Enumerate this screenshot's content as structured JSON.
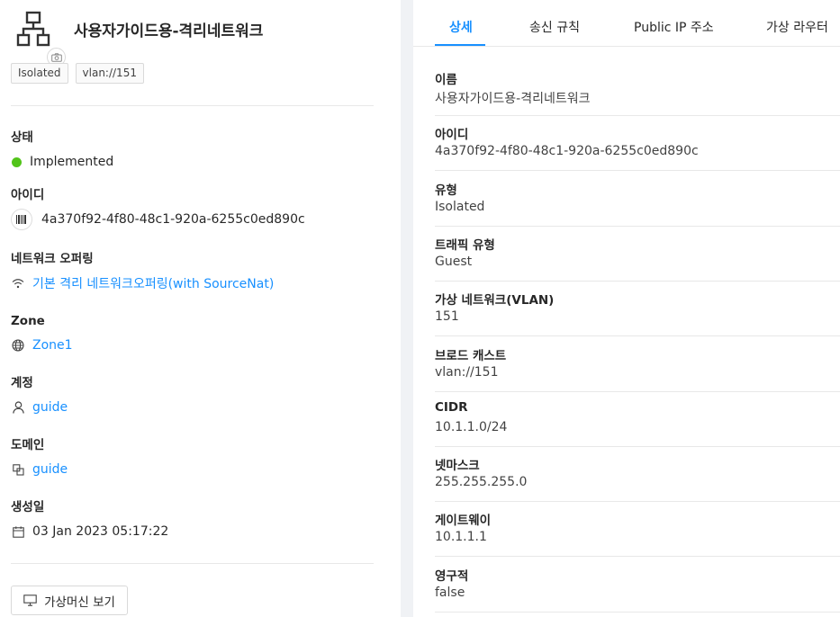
{
  "header": {
    "title": "사용자가이드용-격리네트워크",
    "tags": [
      "Isolated",
      "vlan://151"
    ]
  },
  "fields": {
    "status": {
      "label": "상태",
      "value": "Implemented",
      "color": "#52c41a"
    },
    "id": {
      "label": "아이디",
      "value": "4a370f92-4f80-48c1-920a-6255c0ed890c",
      "icon": "barcode-icon"
    },
    "offering": {
      "label": "네트워크 오퍼링",
      "value": "기본 격리 네트워크오퍼링(with SourceNat)",
      "icon": "wifi-icon"
    },
    "zone": {
      "label": "Zone",
      "value": "Zone1",
      "icon": "globe-icon"
    },
    "account": {
      "label": "계정",
      "value": "guide",
      "icon": "user-icon"
    },
    "domain": {
      "label": "도메인",
      "value": "guide",
      "icon": "block-icon"
    },
    "created": {
      "label": "생성일",
      "value": "03 Jan 2023 05:17:22",
      "icon": "calendar-icon"
    }
  },
  "vm_button": {
    "label": "가상머신 보기",
    "icon": "desktop-icon"
  },
  "tabs": [
    {
      "label": "상세",
      "active": true
    },
    {
      "label": "송신 규칙"
    },
    {
      "label": "Public IP 주소"
    },
    {
      "label": "가상 라우터"
    }
  ],
  "details": [
    {
      "label": "이름",
      "value": "사용자가이드용-격리네트워크"
    },
    {
      "label": "아이디",
      "value": "4a370f92-4f80-48c1-920a-6255c0ed890c"
    },
    {
      "label": "유형",
      "value": "Isolated"
    },
    {
      "label": "트래픽 유형",
      "value": "Guest"
    },
    {
      "label": "가상 네트워크(VLAN)",
      "value": "151"
    },
    {
      "label": "브로드 캐스트",
      "value": "vlan://151"
    },
    {
      "label": "CIDR",
      "value": "10.1.1.0/24"
    },
    {
      "label": "넷마스크",
      "value": "255.255.255.0"
    },
    {
      "label": "게이트웨이",
      "value": "10.1.1.1"
    },
    {
      "label": "영구적",
      "value": "false"
    }
  ],
  "colors": {
    "accent": "#1890ff",
    "success": "#52c41a",
    "background": "#f0f2f5"
  }
}
